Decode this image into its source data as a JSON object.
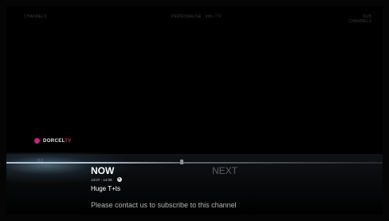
{
  "header": {
    "left_text": "CHANNELS",
    "center_text": "PERSONALISE · Info / TV",
    "right_line1": "SUB",
    "right_line2": "CHANNELS"
  },
  "channel": {
    "logo_icon": "dot-icon",
    "logo_text": "DORCEL",
    "logo_suffix": "TV",
    "number": "112",
    "brand_color": "#c0297a"
  },
  "program": {
    "now_label": "NOW",
    "next_label": "NEXT",
    "time_range": "13:07 - 14:08",
    "clock_icon": "clock-icon",
    "title": "Huge T+ts",
    "message": "Please contact us to subscribe to this channel"
  }
}
